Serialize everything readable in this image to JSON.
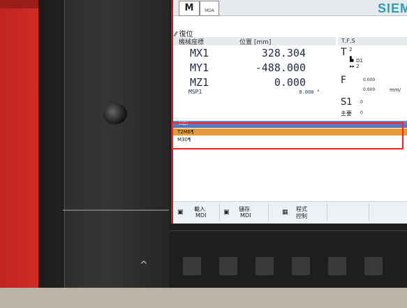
{
  "header": {
    "mode_button": "M",
    "mdi_button": "MDA",
    "brand": "SIEM"
  },
  "status": {
    "reset_label": "復位"
  },
  "positions": {
    "col_axis": "機械座標",
    "col_pos": "位置 [mm]",
    "axes": [
      {
        "name": "MX1",
        "value": "328.304"
      },
      {
        "name": "MY1",
        "value": "-488.000"
      },
      {
        "name": "MZ1",
        "value": "0.000"
      }
    ],
    "spindle": {
      "name": "MSP1",
      "value": "0.000 °"
    }
  },
  "tfs": {
    "header": "T,F,S",
    "t_label": "T",
    "t_value": "2",
    "t_d": "D1",
    "t_next": "▸▸ 2",
    "f_label": "F",
    "f_value1": "0.000",
    "f_value2": "0.000",
    "f_unit": "mm/",
    "s_label": "S1",
    "s_value": "0",
    "main_label": "主要",
    "main_value": "0"
  },
  "mdi": {
    "title": "MDI",
    "lines": [
      "T2M6¶",
      "M30¶"
    ]
  },
  "softkeys": [
    {
      "line1": "載入",
      "line2": "MDI"
    },
    {
      "line1": "儲存",
      "line2": "MDI"
    },
    {
      "line1": "程式",
      "line2": "控制"
    }
  ],
  "hardware": {
    "up_key": "^"
  }
}
